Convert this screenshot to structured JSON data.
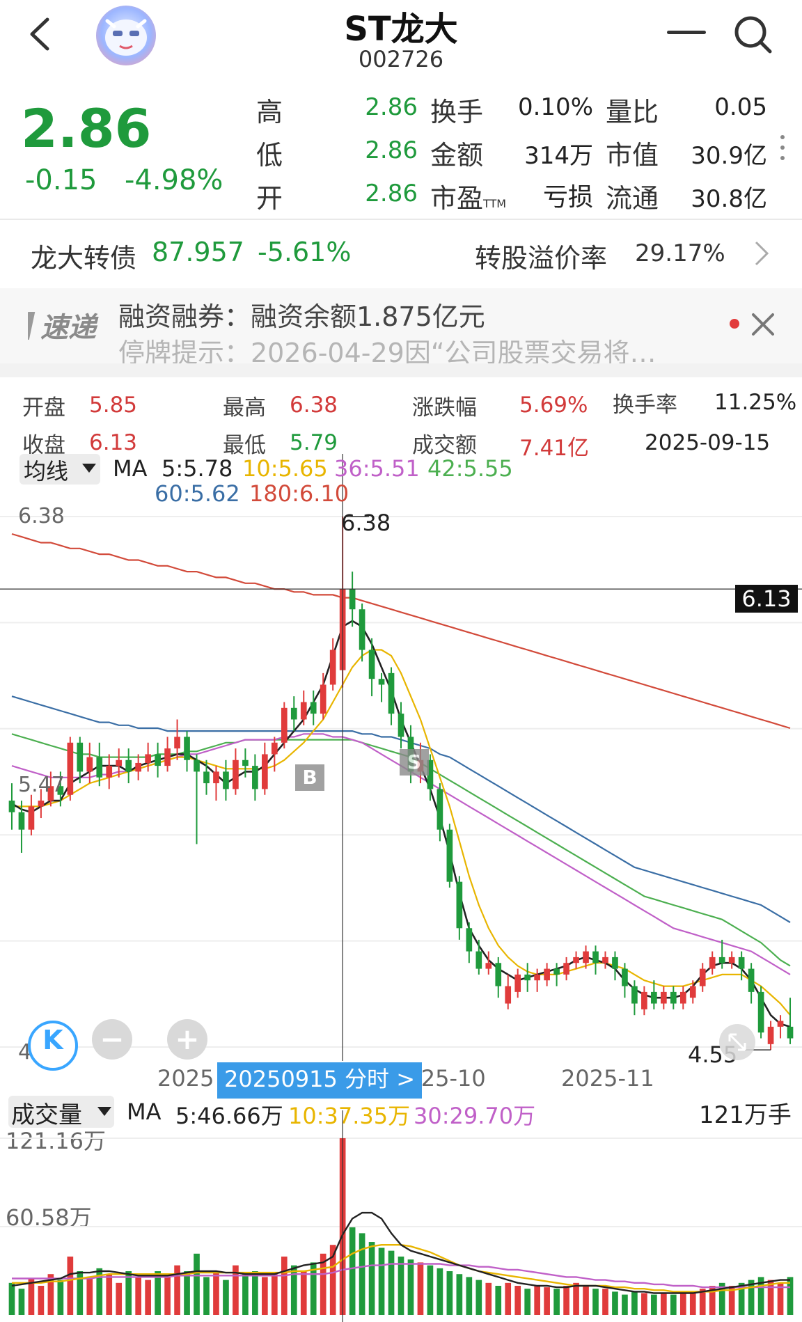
{
  "header": {
    "title": "ST龙大",
    "code": "002726"
  },
  "quote": {
    "price": "2.86",
    "change": "-0.15",
    "change_pct": "-4.98%",
    "stats": [
      {
        "label1": "高",
        "val1": "2.86",
        "label2": "换手",
        "val2": "0.10%",
        "label3": "量比",
        "val3": "0.05"
      },
      {
        "label1": "低",
        "val1": "2.86",
        "label2": "金额",
        "val2": "314万",
        "label3": "市值",
        "val3": "30.9亿"
      },
      {
        "label1": "开",
        "val1": "2.86",
        "label2": "市盈",
        "label2_sub": "TTM",
        "val2": "亏损",
        "label3": "流通",
        "val3": "30.8亿"
      }
    ]
  },
  "convertible": {
    "name": "龙大转债",
    "price": "87.957",
    "change_pct": "-5.61%",
    "premium_label": "转股溢价率",
    "premium_value": "29.17%"
  },
  "news": {
    "logo": "速递",
    "line1": "融资融券：融资余额1.875亿元",
    "line2": "停牌提示：2026-04-29因“公司股票交易将…"
  },
  "day_stats": {
    "open_label": "开盘",
    "open": "5.85",
    "high_label": "最高",
    "high": "6.38",
    "chg_label": "涨跌幅",
    "chg": "5.69%",
    "turnover_label": "换手率",
    "turnover": "11.25%",
    "close_label": "收盘",
    "close": "6.13",
    "low_label": "最低",
    "low": "5.79",
    "amount_label": "成交额",
    "amount": "7.41亿",
    "date": "2025-09-15"
  },
  "kline": {
    "indicator_select": "均线",
    "ma_label": "MA",
    "ma_values": [
      {
        "text": "5:5.78",
        "color": "#222222"
      },
      {
        "text": "10:5.65",
        "color": "#e8b500"
      },
      {
        "text": "36:5.51",
        "color": "#c060c8"
      },
      {
        "text": "42:5.55",
        "color": "#4caf50"
      },
      {
        "text": "60:5.62",
        "color": "#3a6ea5"
      },
      {
        "text": "180:6.10",
        "color": "#d24a3a"
      }
    ],
    "y_top": "6.38",
    "y_mid": "5.47",
    "y_bottom": "4.55",
    "max_annotation": "6.38",
    "min_annotation": "4.55",
    "cross_price": "6.13",
    "x_labels": [
      "2025",
      "2025-10",
      "2025-11"
    ],
    "date_tag": "20250915 分时 >",
    "buy_marker": "B",
    "sell_marker": "S",
    "k_button": "K",
    "zoom_out": "−",
    "zoom_in": "+"
  },
  "volume": {
    "indicator_select": "成交量",
    "ma_label": "MA",
    "ma_values": [
      {
        "text": "5:46.66万",
        "color": "#222222"
      },
      {
        "text": "10:37.35万",
        "color": "#e8b500"
      },
      {
        "text": "30:29.70万",
        "color": "#c060c8"
      }
    ],
    "right_label": "121万手",
    "y_top": "121.16万",
    "y_mid": "60.58万"
  },
  "chart_data": {
    "type": "candlestick",
    "ylim": [
      4.55,
      6.38
    ],
    "candles": [
      [
        5.4,
        5.36,
        5.46,
        5.3
      ],
      [
        5.36,
        5.3,
        5.4,
        5.22
      ],
      [
        5.3,
        5.38,
        5.42,
        5.28
      ],
      [
        5.38,
        5.4,
        5.44,
        5.34
      ],
      [
        5.4,
        5.45,
        5.5,
        5.38
      ],
      [
        5.45,
        5.42,
        5.5,
        5.38
      ],
      [
        5.42,
        5.6,
        5.62,
        5.4
      ],
      [
        5.6,
        5.5,
        5.62,
        5.46
      ],
      [
        5.5,
        5.55,
        5.6,
        5.46
      ],
      [
        5.55,
        5.48,
        5.6,
        5.45
      ],
      [
        5.48,
        5.52,
        5.56,
        5.44
      ],
      [
        5.52,
        5.54,
        5.58,
        5.48
      ],
      [
        5.54,
        5.5,
        5.58,
        5.46
      ],
      [
        5.5,
        5.53,
        5.56,
        5.47
      ],
      [
        5.53,
        5.56,
        5.6,
        5.5
      ],
      [
        5.56,
        5.52,
        5.6,
        5.48
      ],
      [
        5.52,
        5.58,
        5.62,
        5.5
      ],
      [
        5.58,
        5.62,
        5.68,
        5.54
      ],
      [
        5.62,
        5.54,
        5.64,
        5.5
      ],
      [
        5.54,
        5.5,
        5.56,
        5.25
      ],
      [
        5.5,
        5.46,
        5.54,
        5.42
      ],
      [
        5.46,
        5.5,
        5.52,
        5.4
      ],
      [
        5.5,
        5.44,
        5.54,
        5.4
      ],
      [
        5.44,
        5.54,
        5.58,
        5.42
      ],
      [
        5.54,
        5.52,
        5.58,
        5.48
      ],
      [
        5.52,
        5.44,
        5.56,
        5.4
      ],
      [
        5.44,
        5.56,
        5.6,
        5.42
      ],
      [
        5.56,
        5.6,
        5.62,
        5.5
      ],
      [
        5.6,
        5.72,
        5.74,
        5.58
      ],
      [
        5.72,
        5.68,
        5.76,
        5.64
      ],
      [
        5.68,
        5.74,
        5.78,
        5.66
      ],
      [
        5.74,
        5.7,
        5.78,
        5.66
      ],
      [
        5.7,
        5.8,
        5.84,
        5.68
      ],
      [
        5.8,
        5.92,
        5.96,
        5.78
      ],
      [
        5.85,
        6.13,
        6.38,
        5.79
      ],
      [
        6.13,
        6.06,
        6.19,
        6.0
      ],
      [
        6.06,
        5.92,
        6.08,
        5.88
      ],
      [
        5.92,
        5.82,
        5.96,
        5.76
      ],
      [
        5.82,
        5.8,
        5.84,
        5.74
      ],
      [
        5.84,
        5.7,
        5.86,
        5.66
      ],
      [
        5.7,
        5.62,
        5.74,
        5.58
      ],
      [
        5.62,
        5.5,
        5.66,
        5.46
      ],
      [
        5.5,
        5.54,
        5.6,
        5.46
      ],
      [
        5.54,
        5.44,
        5.56,
        5.4
      ],
      [
        5.44,
        5.3,
        5.46,
        5.26
      ],
      [
        5.3,
        5.12,
        5.32,
        5.1
      ],
      [
        5.12,
        4.96,
        5.14,
        4.92
      ],
      [
        4.96,
        4.88,
        4.98,
        4.84
      ],
      [
        4.88,
        4.82,
        4.92,
        4.8
      ],
      [
        4.82,
        4.84,
        4.88,
        4.8
      ],
      [
        4.84,
        4.76,
        4.86,
        4.72
      ],
      [
        4.7,
        4.76,
        4.8,
        4.68
      ],
      [
        4.74,
        4.8,
        4.82,
        4.72
      ],
      [
        4.8,
        4.78,
        4.84,
        4.74
      ],
      [
        4.78,
        4.8,
        4.82,
        4.74
      ],
      [
        4.78,
        4.82,
        4.84,
        4.76
      ],
      [
        4.82,
        4.8,
        4.84,
        4.76
      ],
      [
        4.8,
        4.84,
        4.86,
        4.78
      ],
      [
        4.84,
        4.86,
        4.88,
        4.82
      ],
      [
        4.84,
        4.88,
        4.9,
        4.82
      ],
      [
        4.88,
        4.84,
        4.9,
        4.8
      ],
      [
        4.84,
        4.86,
        4.88,
        4.82
      ],
      [
        4.86,
        4.82,
        4.88,
        4.78
      ],
      [
        4.82,
        4.76,
        4.84,
        4.72
      ],
      [
        4.76,
        4.7,
        4.78,
        4.66
      ],
      [
        4.68,
        4.74,
        4.76,
        4.66
      ],
      [
        4.74,
        4.7,
        4.78,
        4.68
      ],
      [
        4.7,
        4.74,
        4.76,
        4.68
      ],
      [
        4.74,
        4.7,
        4.76,
        4.68
      ],
      [
        4.7,
        4.74,
        4.76,
        4.68
      ],
      [
        4.72,
        4.76,
        4.78,
        4.7
      ],
      [
        4.76,
        4.82,
        4.84,
        4.74
      ],
      [
        4.82,
        4.86,
        4.88,
        4.8
      ],
      [
        4.86,
        4.84,
        4.92,
        4.82
      ],
      [
        4.84,
        4.86,
        4.88,
        4.82
      ],
      [
        4.86,
        4.82,
        4.88,
        4.78
      ],
      [
        4.82,
        4.74,
        4.84,
        4.7
      ],
      [
        4.74,
        4.6,
        4.76,
        4.58
      ],
      [
        4.56,
        4.62,
        4.64,
        4.54
      ],
      [
        4.62,
        4.64,
        4.66,
        4.58
      ],
      [
        4.62,
        4.58,
        4.72,
        4.56
      ]
    ],
    "ma_lines": {
      "ma5": [
        5.39,
        5.37,
        5.36,
        5.38,
        5.4,
        5.4,
        5.46,
        5.48,
        5.5,
        5.52,
        5.52,
        5.52,
        5.5,
        5.52,
        5.53,
        5.54,
        5.55,
        5.56,
        5.56,
        5.54,
        5.52,
        5.49,
        5.46,
        5.48,
        5.5,
        5.5,
        5.52,
        5.56,
        5.6,
        5.64,
        5.68,
        5.74,
        5.8,
        5.9,
        6.0,
        6.02,
        6.0,
        5.94,
        5.86,
        5.78,
        5.68,
        5.6,
        5.52,
        5.44,
        5.34,
        5.22,
        5.08,
        4.96,
        4.9,
        4.85,
        4.82,
        4.8,
        4.78,
        4.79,
        4.8,
        4.81,
        4.82,
        4.83,
        4.85,
        4.86,
        4.85,
        4.84,
        4.82,
        4.78,
        4.75,
        4.73,
        4.72,
        4.72,
        4.72,
        4.73,
        4.76,
        4.8,
        4.83,
        4.84,
        4.84,
        4.82,
        4.78,
        4.72,
        4.66,
        4.63,
        4.62
      ],
      "ma10": [
        5.38,
        5.38,
        5.38,
        5.38,
        5.39,
        5.4,
        5.42,
        5.44,
        5.46,
        5.47,
        5.48,
        5.49,
        5.5,
        5.51,
        5.52,
        5.53,
        5.54,
        5.55,
        5.55,
        5.54,
        5.53,
        5.52,
        5.51,
        5.51,
        5.51,
        5.51,
        5.51,
        5.52,
        5.54,
        5.57,
        5.6,
        5.64,
        5.68,
        5.74,
        5.8,
        5.86,
        5.9,
        5.92,
        5.92,
        5.9,
        5.84,
        5.76,
        5.68,
        5.58,
        5.48,
        5.38,
        5.26,
        5.14,
        5.04,
        4.96,
        4.9,
        4.86,
        4.83,
        4.81,
        4.8,
        4.8,
        4.8,
        4.81,
        4.82,
        4.83,
        4.84,
        4.84,
        4.83,
        4.82,
        4.8,
        4.78,
        4.77,
        4.76,
        4.76,
        4.76,
        4.77,
        4.78,
        4.79,
        4.8,
        4.8,
        4.8,
        4.78,
        4.76,
        4.73,
        4.7,
        4.66
      ],
      "ma36": [
        5.52,
        5.51,
        5.5,
        5.49,
        5.48,
        5.48,
        5.48,
        5.48,
        5.48,
        5.49,
        5.49,
        5.5,
        5.5,
        5.51,
        5.52,
        5.53,
        5.54,
        5.55,
        5.56,
        5.56,
        5.57,
        5.58,
        5.59,
        5.6,
        5.61,
        5.61,
        5.61,
        5.61,
        5.62,
        5.62,
        5.63,
        5.63,
        5.63,
        5.62,
        5.62,
        5.61,
        5.6,
        5.58,
        5.56,
        5.54,
        5.52,
        5.5,
        5.48,
        5.46,
        5.44,
        5.42,
        5.4,
        5.38,
        5.36,
        5.34,
        5.32,
        5.3,
        5.28,
        5.26,
        5.24,
        5.22,
        5.2,
        5.18,
        5.16,
        5.14,
        5.12,
        5.1,
        5.08,
        5.06,
        5.04,
        5.02,
        5.0,
        4.98,
        4.96,
        4.95,
        4.94,
        4.93,
        4.92,
        4.91,
        4.9,
        4.89,
        4.88,
        4.86,
        4.84,
        4.82,
        4.8
      ],
      "ma42": [
        5.63,
        5.62,
        5.61,
        5.6,
        5.59,
        5.58,
        5.57,
        5.56,
        5.56,
        5.55,
        5.55,
        5.55,
        5.55,
        5.55,
        5.55,
        5.56,
        5.56,
        5.56,
        5.57,
        5.57,
        5.58,
        5.59,
        5.6,
        5.6,
        5.61,
        5.61,
        5.61,
        5.61,
        5.61,
        5.61,
        5.61,
        5.61,
        5.61,
        5.61,
        5.61,
        5.61,
        5.6,
        5.59,
        5.58,
        5.57,
        5.56,
        5.55,
        5.53,
        5.51,
        5.49,
        5.47,
        5.45,
        5.43,
        5.41,
        5.39,
        5.37,
        5.35,
        5.33,
        5.31,
        5.29,
        5.27,
        5.25,
        5.23,
        5.21,
        5.19,
        5.17,
        5.15,
        5.13,
        5.11,
        5.09,
        5.07,
        5.06,
        5.05,
        5.04,
        5.03,
        5.02,
        5.01,
        5.0,
        4.99,
        4.97,
        4.95,
        4.93,
        4.91,
        4.88,
        4.85,
        4.83
      ],
      "ma60": [
        5.76,
        5.75,
        5.74,
        5.73,
        5.72,
        5.71,
        5.7,
        5.69,
        5.68,
        5.67,
        5.67,
        5.66,
        5.66,
        5.65,
        5.65,
        5.65,
        5.64,
        5.64,
        5.64,
        5.64,
        5.64,
        5.64,
        5.64,
        5.64,
        5.64,
        5.64,
        5.64,
        5.64,
        5.64,
        5.64,
        5.64,
        5.64,
        5.64,
        5.64,
        5.64,
        5.64,
        5.63,
        5.63,
        5.62,
        5.62,
        5.61,
        5.6,
        5.59,
        5.58,
        5.56,
        5.55,
        5.53,
        5.51,
        5.49,
        5.47,
        5.45,
        5.43,
        5.41,
        5.39,
        5.37,
        5.35,
        5.33,
        5.31,
        5.29,
        5.27,
        5.25,
        5.23,
        5.21,
        5.19,
        5.17,
        5.16,
        5.15,
        5.14,
        5.13,
        5.12,
        5.11,
        5.1,
        5.09,
        5.08,
        5.07,
        5.06,
        5.05,
        5.04,
        5.02,
        5.0,
        4.98
      ],
      "ma180": [
        6.32,
        6.31,
        6.3,
        6.29,
        6.29,
        6.28,
        6.27,
        6.27,
        6.26,
        6.25,
        6.25,
        6.24,
        6.23,
        6.23,
        6.22,
        6.21,
        6.21,
        6.2,
        6.19,
        6.19,
        6.18,
        6.17,
        6.17,
        6.16,
        6.15,
        6.15,
        6.14,
        6.13,
        6.13,
        6.12,
        6.12,
        6.11,
        6.11,
        6.11,
        6.1,
        6.1,
        6.09,
        6.08,
        6.07,
        6.06,
        6.05,
        6.04,
        6.03,
        6.02,
        6.01,
        6.0,
        5.99,
        5.98,
        5.97,
        5.96,
        5.95,
        5.94,
        5.93,
        5.92,
        5.91,
        5.9,
        5.89,
        5.88,
        5.87,
        5.86,
        5.85,
        5.84,
        5.83,
        5.82,
        5.81,
        5.8,
        5.79,
        5.78,
        5.77,
        5.76,
        5.75,
        5.74,
        5.73,
        5.72,
        5.71,
        5.7,
        5.69,
        5.68,
        5.67,
        5.66,
        5.65
      ]
    },
    "volume": [
      22,
      18,
      25,
      20,
      28,
      24,
      40,
      30,
      26,
      32,
      28,
      22,
      30,
      26,
      24,
      30,
      28,
      34,
      30,
      42,
      26,
      30,
      24,
      34,
      28,
      30,
      26,
      28,
      40,
      34,
      30,
      36,
      42,
      48,
      121,
      60,
      56,
      50,
      46,
      44,
      40,
      38,
      36,
      34,
      32,
      30,
      28,
      26,
      24,
      22,
      20,
      22,
      20,
      18,
      20,
      19,
      18,
      20,
      22,
      20,
      18,
      18,
      16,
      14,
      16,
      15,
      14,
      15,
      14,
      15,
      16,
      18,
      20,
      22,
      20,
      22,
      24,
      26,
      24,
      22,
      26
    ],
    "volume_ma5": [
      20,
      21,
      22,
      23,
      24,
      25,
      28,
      29,
      29,
      30,
      30,
      29,
      28,
      27,
      27,
      27,
      27,
      28,
      29,
      30,
      30,
      30,
      29,
      29,
      28,
      28,
      28,
      28,
      30,
      32,
      34,
      35,
      36,
      40,
      55,
      66,
      70,
      70,
      66,
      56,
      48,
      44,
      42,
      40,
      38,
      36,
      34,
      32,
      30,
      28,
      26,
      24,
      22,
      21,
      20,
      20,
      19,
      19,
      20,
      20,
      20,
      19,
      18,
      17,
      16,
      16,
      15,
      15,
      15,
      15,
      15,
      16,
      17,
      18,
      19,
      20,
      21,
      22,
      23,
      24,
      24
    ],
    "volume_ma10": [
      22,
      22,
      22,
      22,
      23,
      23,
      24,
      25,
      26,
      27,
      28,
      28,
      28,
      28,
      28,
      28,
      28,
      28,
      28,
      29,
      29,
      29,
      29,
      29,
      29,
      29,
      29,
      29,
      29,
      30,
      30,
      31,
      32,
      33,
      38,
      42,
      45,
      47,
      48,
      48,
      48,
      47,
      45,
      43,
      40,
      37,
      34,
      32,
      30,
      29,
      28,
      27,
      26,
      25,
      24,
      23,
      22,
      21,
      20,
      20,
      20,
      20,
      19,
      19,
      18,
      18,
      17,
      17,
      16,
      16,
      16,
      16,
      16,
      17,
      17,
      18,
      19,
      20,
      21,
      22,
      22
    ],
    "volume_ma30": [
      25,
      25,
      25,
      25,
      25,
      25,
      25,
      25,
      25,
      26,
      26,
      26,
      26,
      26,
      26,
      26,
      26,
      27,
      27,
      27,
      27,
      27,
      27,
      27,
      27,
      27,
      27,
      27,
      27,
      28,
      28,
      28,
      28,
      29,
      31,
      32,
      33,
      34,
      34,
      35,
      35,
      35,
      35,
      35,
      35,
      34,
      34,
      34,
      33,
      33,
      32,
      31,
      31,
      30,
      29,
      28,
      27,
      26,
      26,
      25,
      24,
      24,
      23,
      23,
      22,
      22,
      21,
      21,
      20,
      20,
      20,
      19,
      19,
      19,
      19,
      19,
      19,
      19,
      19,
      19,
      19
    ]
  }
}
